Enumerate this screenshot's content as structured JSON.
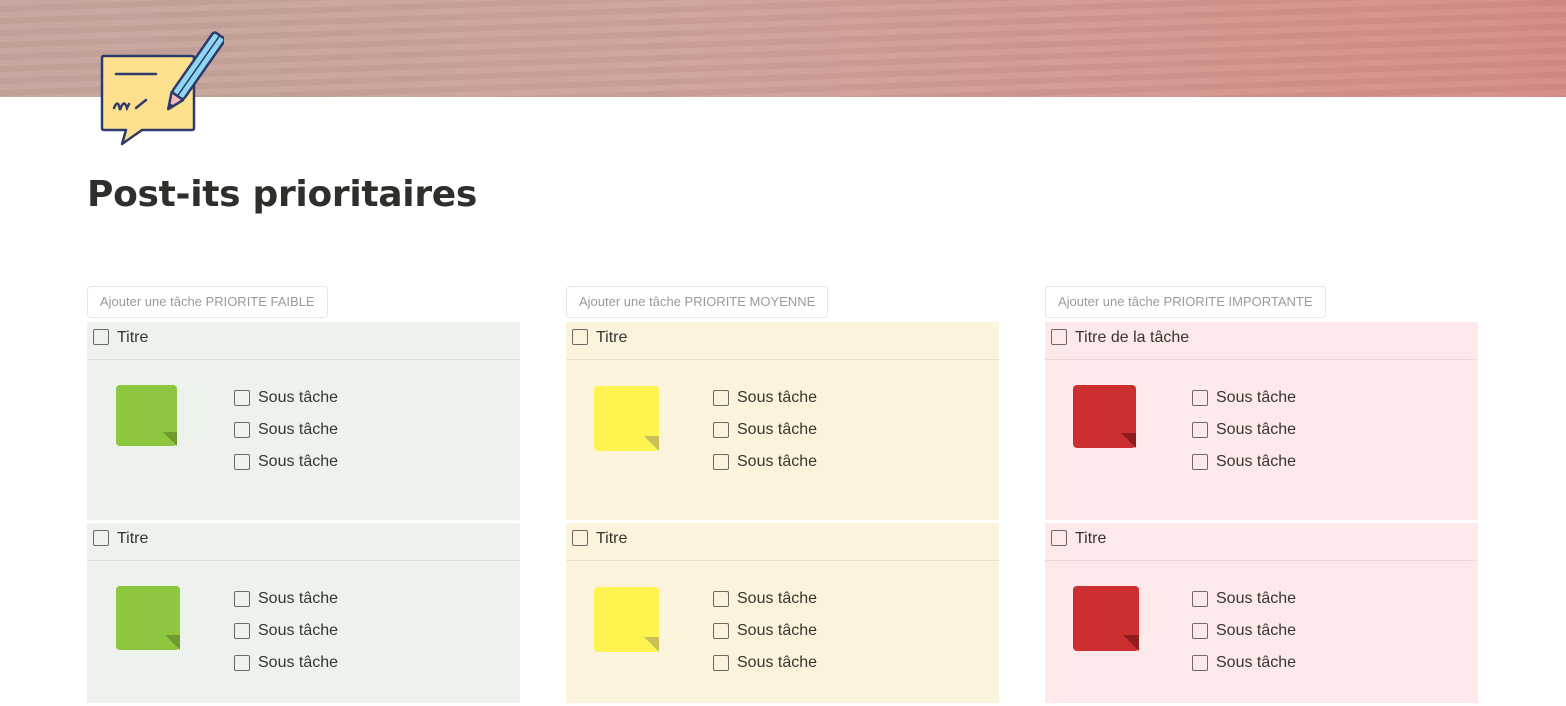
{
  "page": {
    "title": "Post-its prioritaires"
  },
  "colors": {
    "green_bg": "#edf2ec",
    "yellow_bg": "#fbf3dc",
    "red_bg": "#fde9e9",
    "green_note": "#8dc63f",
    "yellow_note": "#fff44f",
    "red_note": "#cc2f2f"
  },
  "columns": [
    {
      "add_button_label": "Ajouter une tâche PRIORITE FAIBLE",
      "note_icon": "green-sticky-note-icon",
      "cards": [
        {
          "title": "Titre",
          "subtasks": [
            "Sous tâche",
            "Sous tâche",
            "Sous tâche"
          ]
        },
        {
          "title": "Titre",
          "subtasks": [
            "Sous tâche",
            "Sous tâche",
            "Sous tâche"
          ]
        }
      ]
    },
    {
      "add_button_label": "Ajouter une tâche PRIORITE MOYENNE",
      "note_icon": "yellow-sticky-note-icon",
      "cards": [
        {
          "title": "Titre",
          "subtasks": [
            "Sous tâche",
            "Sous tâche",
            "Sous tâche"
          ]
        },
        {
          "title": "Titre",
          "subtasks": [
            "Sous tâche",
            "Sous tâche",
            "Sous tâche"
          ]
        }
      ]
    },
    {
      "add_button_label": "Ajouter une tâche PRIORITE IMPORTANTE",
      "note_icon": "red-sticky-note-icon",
      "cards": [
        {
          "title": "Titre de la tâche",
          "subtasks": [
            "Sous tâche",
            "Sous tâche",
            "Sous tâche"
          ]
        },
        {
          "title": "Titre",
          "subtasks": [
            "Sous tâche",
            "Sous tâche",
            "Sous tâche"
          ]
        }
      ]
    }
  ]
}
